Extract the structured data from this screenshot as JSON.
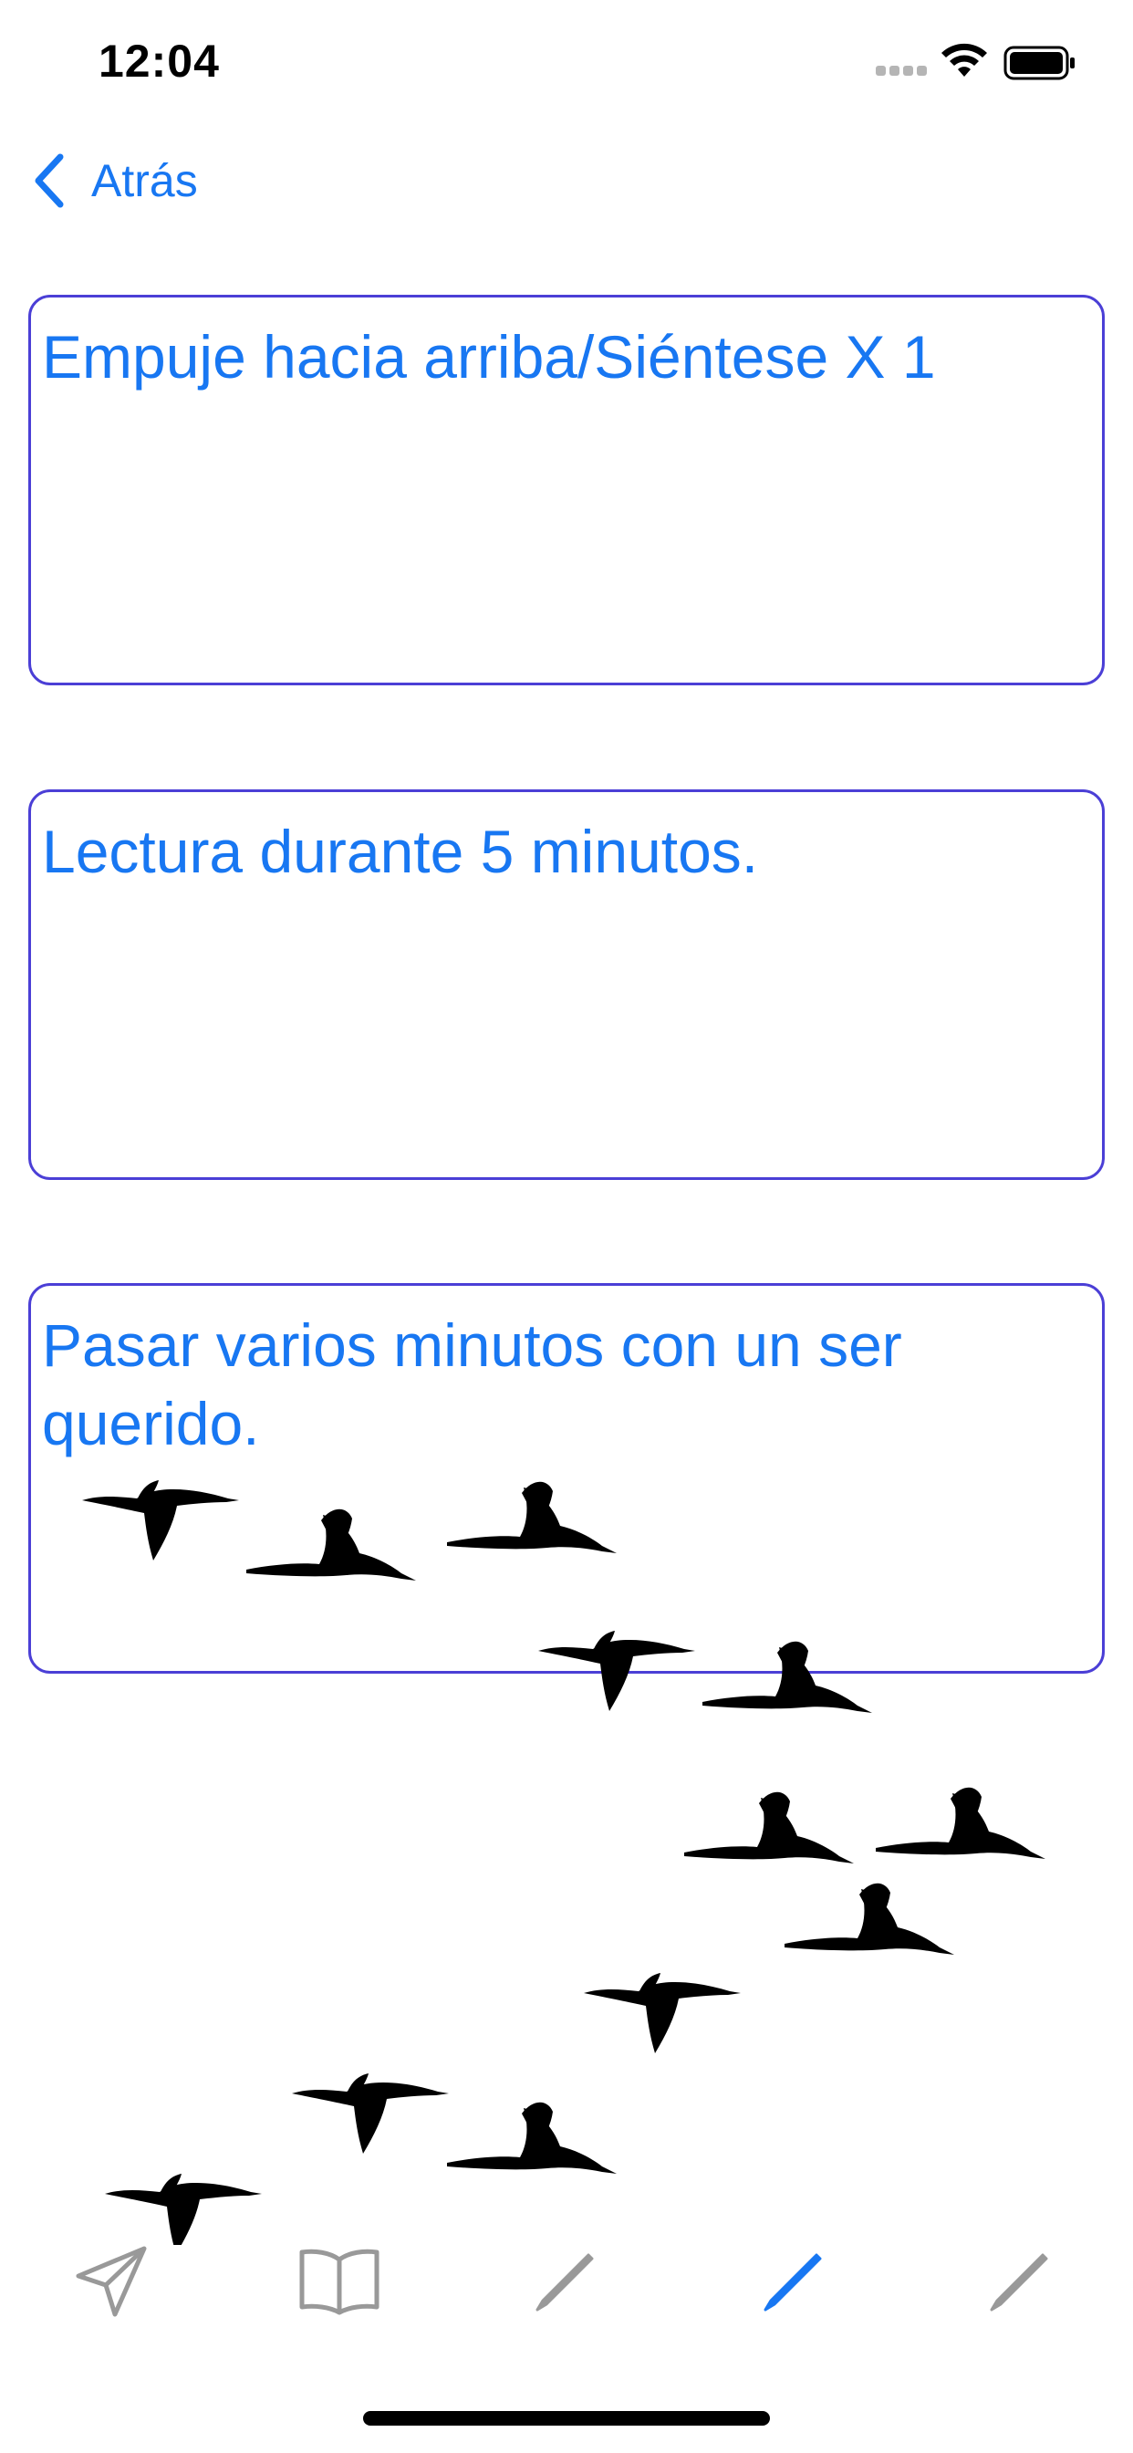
{
  "status_bar": {
    "time": "12:04"
  },
  "nav": {
    "back_label": "Atrás"
  },
  "cards": [
    {
      "text": "Empuje hacia arriba/Siéntese X 1"
    },
    {
      "text": "Lectura durante 5 minutos."
    },
    {
      "text": "Pasar varios minutos con un ser querido."
    }
  ],
  "tab_bar": {
    "items": [
      {
        "icon": "paper-plane-icon",
        "selected": false
      },
      {
        "icon": "book-icon",
        "selected": false
      },
      {
        "icon": "pencil-icon",
        "selected": false
      },
      {
        "icon": "pencil-icon",
        "selected": true
      },
      {
        "icon": "pencil-icon",
        "selected": false
      }
    ]
  },
  "colors": {
    "accent": "#1877f2",
    "card_border": "#4b3fd6",
    "tab_inactive": "#999999",
    "tab_active": "#1877f2"
  }
}
